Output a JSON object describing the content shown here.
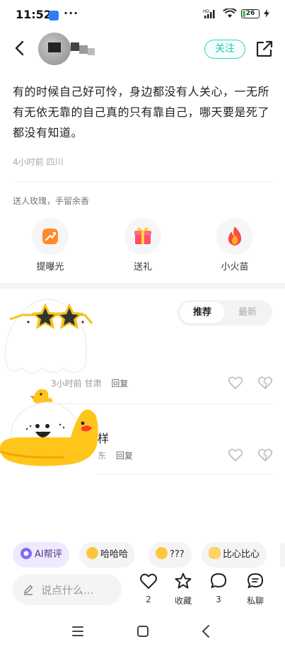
{
  "status": {
    "time": "11:52",
    "dots": "···",
    "battery": "26",
    "battery_level_percent": 26,
    "signal_label": "HD"
  },
  "header": {
    "follow_label": "关注"
  },
  "post": {
    "text": "有的时候自己好可怜，身边都没有人关心，一无所有无依无靠的自己真的只有靠自己，哪天要是死了都没有知道。",
    "meta": "4小时前 四川"
  },
  "gifts": {
    "caption": "送人玫瑰，手留余香",
    "items": [
      {
        "label": "提曝光",
        "icon": "rocket-boost-icon"
      },
      {
        "label": "送礼",
        "icon": "gift-box-icon"
      },
      {
        "label": "小火苗",
        "icon": "flame-icon"
      }
    ]
  },
  "sort": {
    "active": "推荐",
    "inactive": "最新"
  },
  "comments": [
    {
      "text": "",
      "time": "3小时前",
      "location": "甘肃",
      "reply": "回复"
    },
    {
      "text": "样",
      "time": "",
      "location": "东",
      "reply": "回复"
    }
  ],
  "quick_replies": [
    {
      "label": "AI帮评",
      "icon": "ai-icon"
    },
    {
      "label": "哈哈哈",
      "icon": "laughing-emoji-icon"
    },
    {
      "label": "???",
      "icon": "thinking-emoji-icon"
    },
    {
      "label": "比心比心",
      "icon": "heart-hand-emoji-icon"
    }
  ],
  "input": {
    "placeholder": "说点什么..."
  },
  "actions": {
    "like_count": "2",
    "favorite_label": "收藏",
    "comment_count": "3",
    "message_label": "私聊"
  },
  "colors": {
    "accent_teal": "#1fc2b5",
    "gift_orange": "#ff8a2a",
    "flame_red": "#ff4a3d",
    "duck_yellow": "#ffc51a"
  }
}
